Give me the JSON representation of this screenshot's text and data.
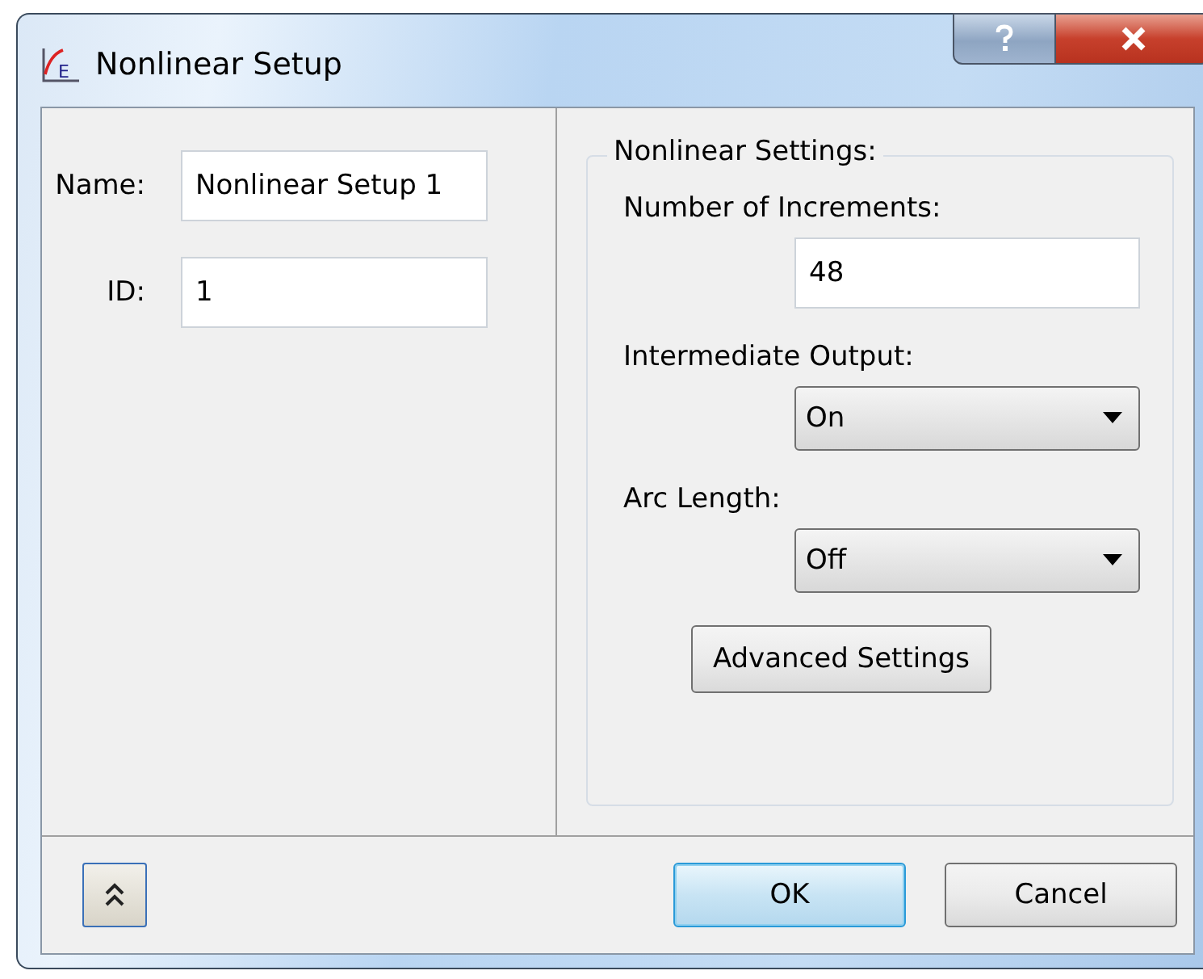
{
  "window": {
    "title": "Nonlinear Setup",
    "icon_text": "E"
  },
  "fields": [
    {
      "label": "Name:",
      "value": "Nonlinear Setup 1"
    },
    {
      "label": "ID:",
      "value": "1"
    }
  ],
  "group": {
    "title": "Nonlinear Settings:",
    "items": [
      {
        "kind": "text",
        "label": "Number of Increments:",
        "value": "48"
      },
      {
        "kind": "dropdown",
        "label": "Intermediate Output:",
        "value": "On"
      },
      {
        "kind": "dropdown",
        "label": "Arc Length:",
        "value": "Off"
      }
    ],
    "button": "Advanced Settings"
  },
  "buttons": [
    {
      "label": "OK",
      "default": true
    },
    {
      "label": "Cancel",
      "default": false
    }
  ]
}
